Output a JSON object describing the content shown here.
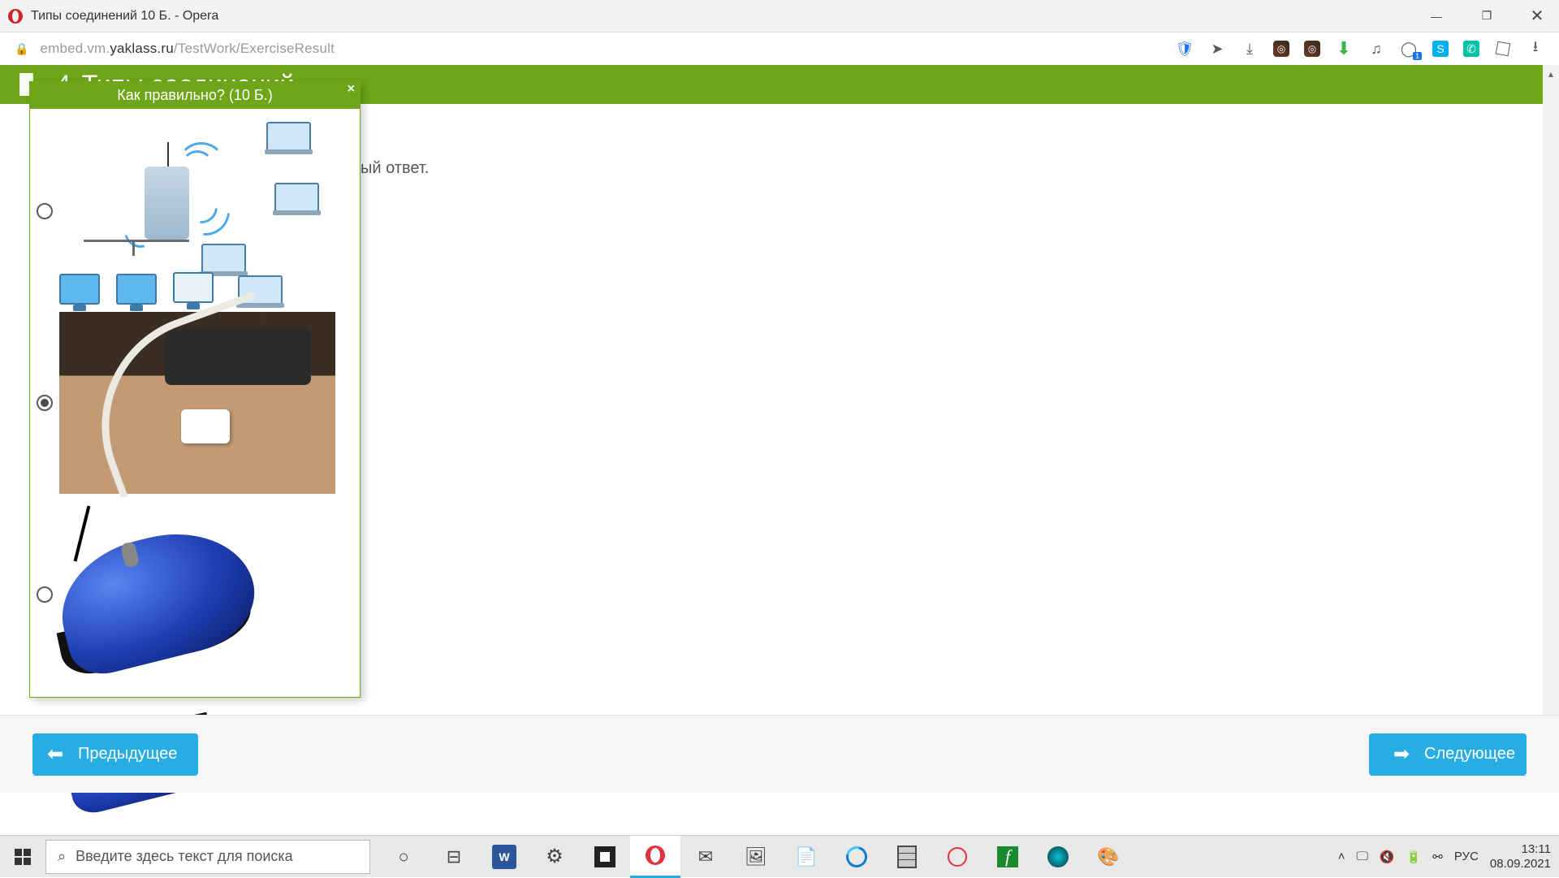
{
  "window": {
    "title": "Типы соединений 10 Б. - Opera"
  },
  "address": {
    "url_prefix": "embed.vm.",
    "url_host": "yaklass.ru",
    "url_path": "/TestWork/ExerciseResult",
    "ext_badge": "1"
  },
  "banner": {
    "number": "4",
    "title": "Типы соединений"
  },
  "popup": {
    "title": "Как правильно? (10 Б.)",
    "close": "×"
  },
  "bg": {
    "hint_suffix": "ый ответ."
  },
  "nav": {
    "prev": "Предыдущее",
    "next": "Следующее"
  },
  "taskbar": {
    "search_placeholder": "Введите здесь текст для поиска",
    "lang": "РУС",
    "time": "13:11",
    "date": "08.09.2021"
  }
}
